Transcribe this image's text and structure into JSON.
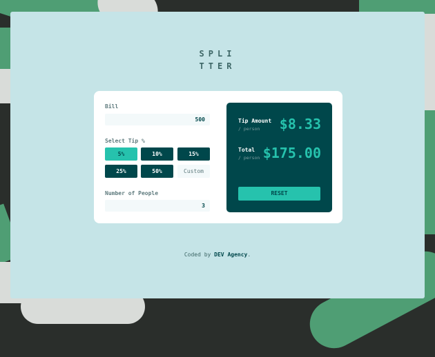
{
  "logo": {
    "line1": "SPLI",
    "line2": "TTER"
  },
  "form": {
    "bill_label": "Bill",
    "bill_value": "500",
    "tip_label": "Select Tip %",
    "tips": [
      "5%",
      "10%",
      "15%",
      "25%",
      "50%"
    ],
    "selected_tip": "5%",
    "custom_placeholder": "Custom",
    "people_label": "Number of People",
    "people_value": "3"
  },
  "results": {
    "tip_title": "Tip Amount",
    "tip_sub": "/ person",
    "tip_value": "$8.33",
    "total_title": "Total",
    "total_sub": "/ person",
    "total_value": "$175.00",
    "reset_label": "RESET"
  },
  "attribution": {
    "prefix": "Coded by",
    "link": "DEV Agency",
    "suffix": "."
  },
  "colors": {
    "accent": "#26c2ad",
    "dark": "#00474b",
    "background": "#c5e4e7"
  }
}
